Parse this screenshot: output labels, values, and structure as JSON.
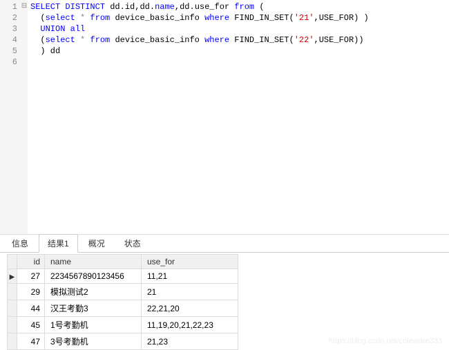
{
  "sql": {
    "lines": [
      {
        "n": "1",
        "fold": "⊟",
        "tokens": [
          {
            "t": "SELECT ",
            "c": "kw"
          },
          {
            "t": "DISTINCT ",
            "c": "kw"
          },
          {
            "t": "dd",
            "c": "id"
          },
          {
            "t": ".",
            "c": ""
          },
          {
            "t": "id",
            "c": "id"
          },
          {
            "t": ",",
            "c": ""
          },
          {
            "t": "dd",
            "c": "id"
          },
          {
            "t": ".",
            "c": ""
          },
          {
            "t": "name",
            "c": "kw"
          },
          {
            "t": ",",
            "c": ""
          },
          {
            "t": "dd",
            "c": "id"
          },
          {
            "t": ".",
            "c": ""
          },
          {
            "t": "use_for",
            "c": "id"
          },
          {
            "t": " from ",
            "c": "kw"
          },
          {
            "t": "(",
            "c": "paren"
          }
        ]
      },
      {
        "n": "2",
        "fold": "",
        "tokens": [
          {
            "t": "  ",
            "c": ""
          },
          {
            "t": "(",
            "c": "paren"
          },
          {
            "t": "select ",
            "c": "kw"
          },
          {
            "t": "*",
            "c": "star"
          },
          {
            "t": " from ",
            "c": "kw"
          },
          {
            "t": "device_basic_info",
            "c": "id"
          },
          {
            "t": " where ",
            "c": "kw"
          },
          {
            "t": "FIND_IN_SET",
            "c": "fn"
          },
          {
            "t": "(",
            "c": "paren"
          },
          {
            "t": "'21'",
            "c": "str"
          },
          {
            "t": ",",
            "c": ""
          },
          {
            "t": "USE_FOR",
            "c": "id"
          },
          {
            "t": ")",
            "c": "paren"
          },
          {
            "t": " )",
            "c": "paren"
          }
        ]
      },
      {
        "n": "3",
        "fold": "",
        "tokens": [
          {
            "t": "  ",
            "c": ""
          },
          {
            "t": "UNION all",
            "c": "kw"
          }
        ]
      },
      {
        "n": "4",
        "fold": "",
        "tokens": [
          {
            "t": "  ",
            "c": ""
          },
          {
            "t": "(",
            "c": "paren"
          },
          {
            "t": "select ",
            "c": "kw"
          },
          {
            "t": "*",
            "c": "star"
          },
          {
            "t": " from ",
            "c": "kw"
          },
          {
            "t": "device_basic_info",
            "c": "id"
          },
          {
            "t": " where ",
            "c": "kw"
          },
          {
            "t": "FIND_IN_SET",
            "c": "fn"
          },
          {
            "t": "(",
            "c": "paren"
          },
          {
            "t": "'22'",
            "c": "str"
          },
          {
            "t": ",",
            "c": ""
          },
          {
            "t": "USE_FOR",
            "c": "id"
          },
          {
            "t": ")",
            "c": "paren"
          },
          {
            "t": ")",
            "c": "paren"
          }
        ]
      },
      {
        "n": "5",
        "fold": "",
        "tokens": [
          {
            "t": "  ",
            "c": ""
          },
          {
            "t": ")",
            "c": "paren"
          },
          {
            "t": " dd",
            "c": "id"
          }
        ]
      },
      {
        "n": "6",
        "fold": "",
        "tokens": []
      }
    ]
  },
  "tabs": [
    {
      "label": "信息",
      "active": false
    },
    {
      "label": "结果1",
      "active": true
    },
    {
      "label": "概况",
      "active": false
    },
    {
      "label": "状态",
      "active": false
    }
  ],
  "columns": [
    "id",
    "name",
    "use_for"
  ],
  "chart_data": {
    "type": "table",
    "columns": [
      "id",
      "name",
      "use_for"
    ],
    "rows": [
      {
        "id": 27,
        "name": "2234567890123456",
        "use_for": "11,21"
      },
      {
        "id": 29,
        "name": "模拟测试2",
        "use_for": "21"
      },
      {
        "id": 44,
        "name": "汉王考勤3",
        "use_for": "22,21,20"
      },
      {
        "id": 45,
        "name": "1号考勤机",
        "use_for": "11,19,20,21,22,23"
      },
      {
        "id": 47,
        "name": "3号考勤机",
        "use_for": "21,23"
      }
    ]
  },
  "current_row_index": 0,
  "watermark": "https://blog.csdn.net/coleware333"
}
